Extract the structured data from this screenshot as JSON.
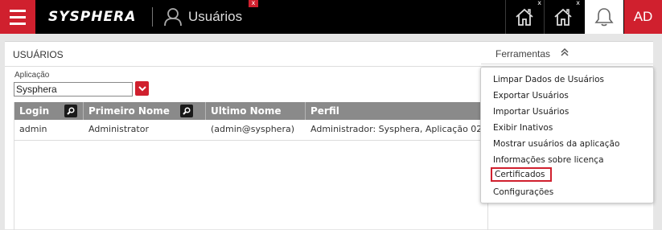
{
  "topbar": {
    "logo": "SYSPHERA",
    "active_tab_label": "Usuários",
    "tab_close": "x",
    "home_close": "x",
    "avatar_initials": "AD"
  },
  "panel": {
    "title": "USUÁRIOS",
    "application_label": "Aplicação",
    "application_value": "Sysphera"
  },
  "grid": {
    "headers": [
      "Login",
      "Primeiro Nome",
      "Ultimo Nome",
      "Perfil"
    ],
    "rows": [
      {
        "login": "admin",
        "first_name": "Administrator",
        "last_name": "(admin@sysphera)",
        "profile": "Administrador: Sysphera, Aplicação 02"
      }
    ]
  },
  "tools": {
    "title": "Ferramentas",
    "items": [
      "Limpar Dados de Usuários",
      "Exportar Usuários",
      "Importar Usuários",
      "Exibir Inativos",
      "Mostrar usuários da aplicação",
      "Informações sobre licença",
      "Certificados",
      "Configurações"
    ],
    "highlighted_item": "Certificados"
  },
  "colors": {
    "brand_red": "#d0202e",
    "topbar": "#000000",
    "grid_header": "#8a8a8a"
  },
  "icons": [
    "menu-icon",
    "user-icon",
    "home-icon",
    "bell-icon",
    "search-icon",
    "chevron-down-icon",
    "double-chevron-up-icon"
  ]
}
